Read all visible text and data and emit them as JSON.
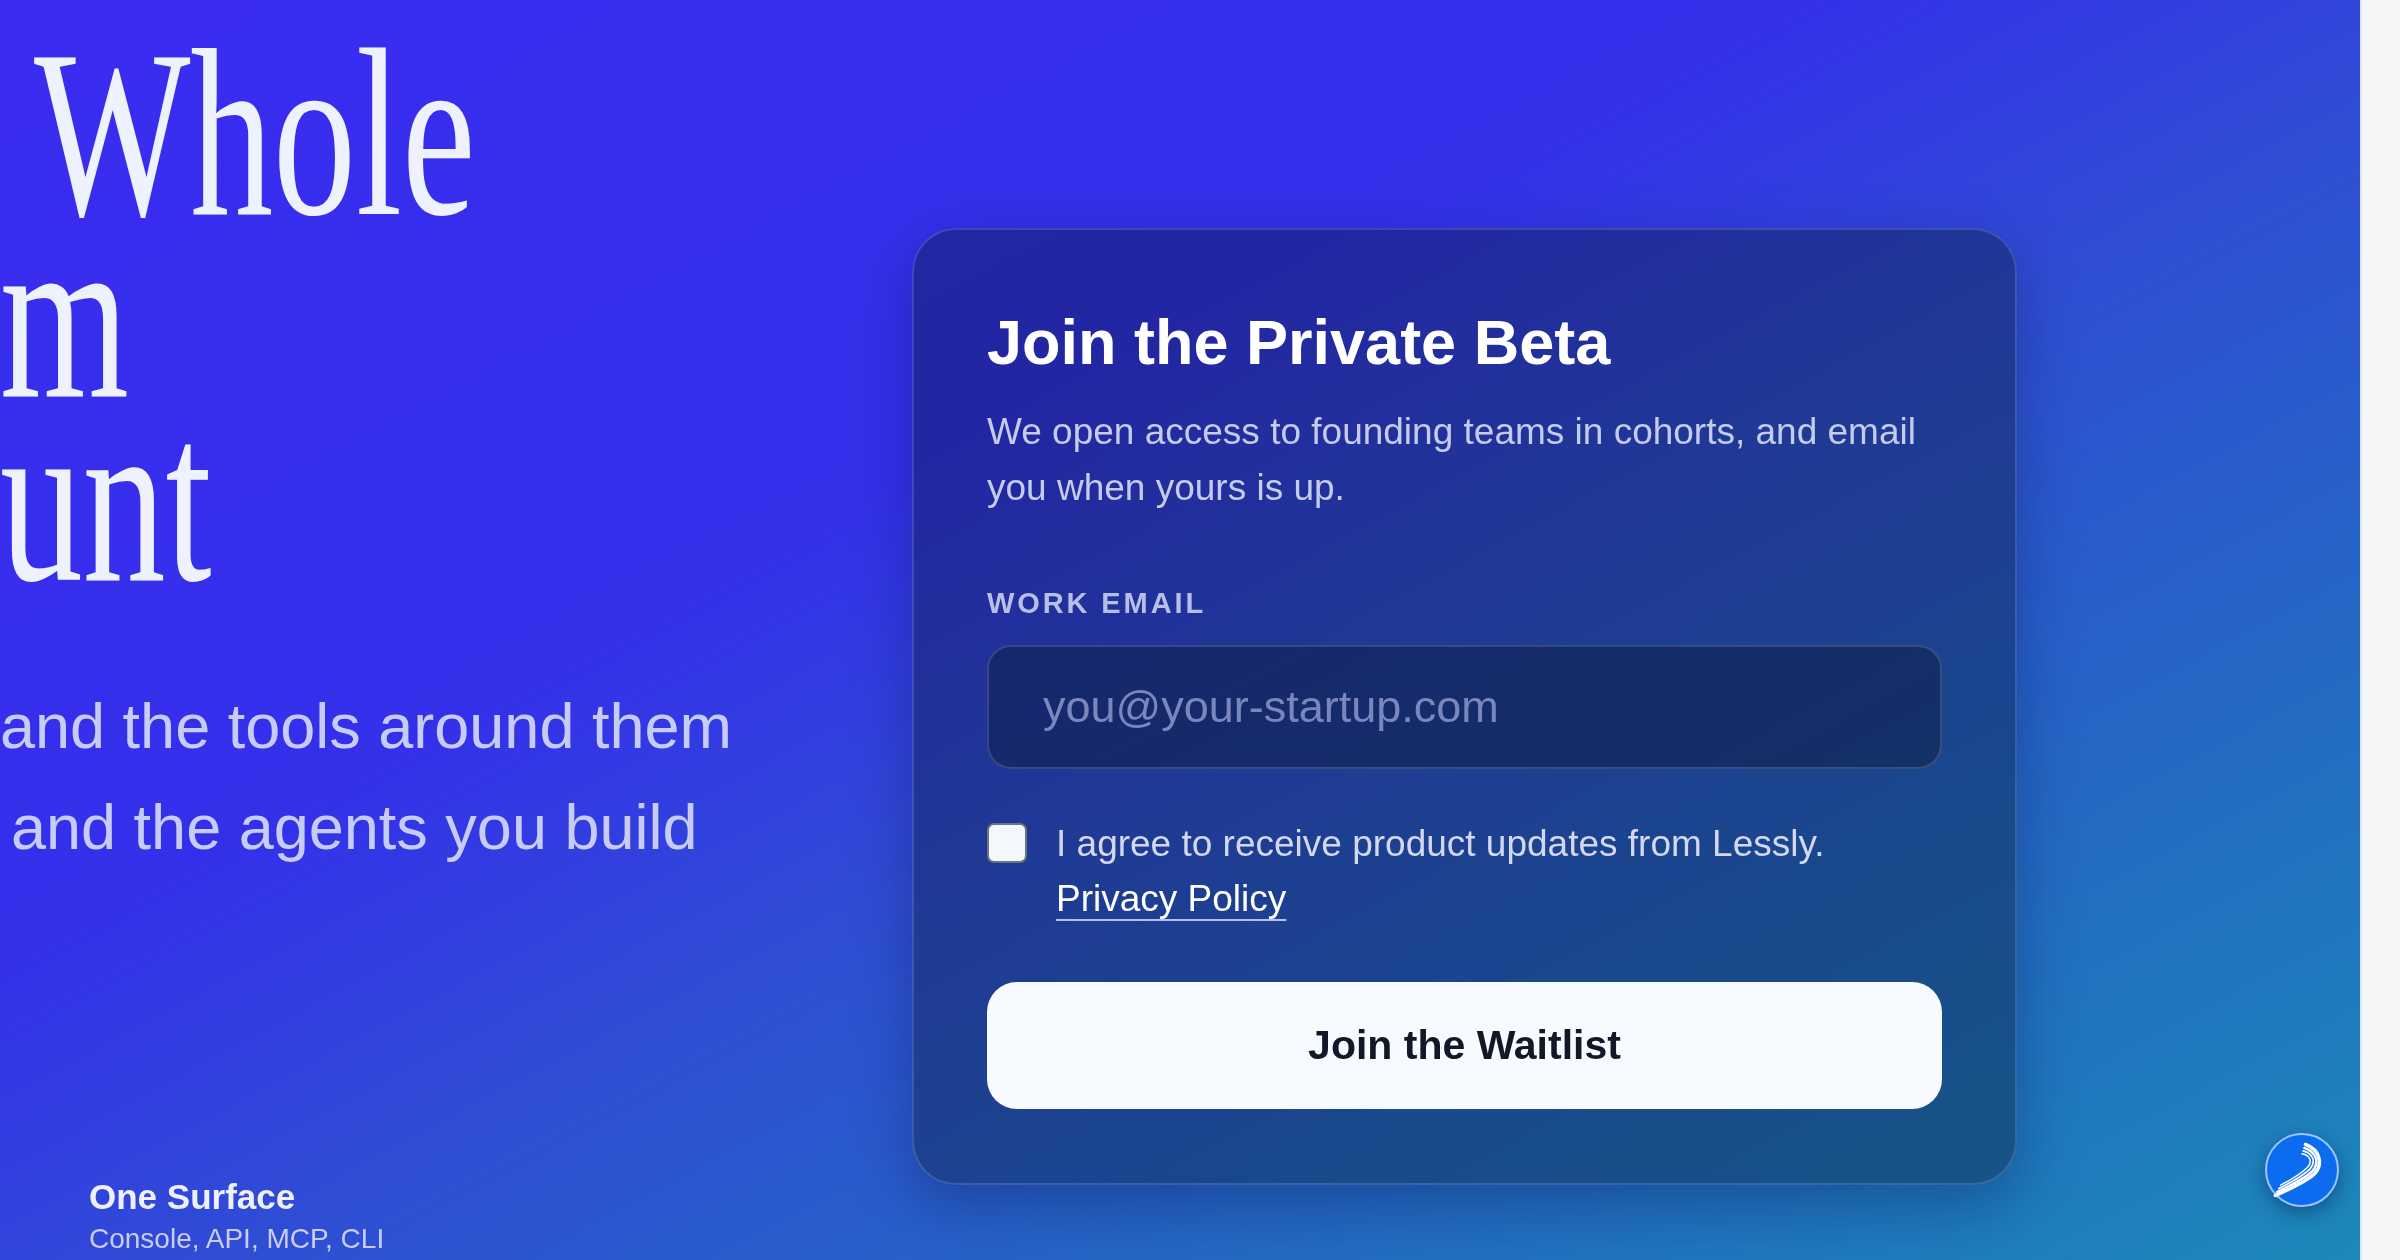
{
  "hero": {
    "headline_lines": [
      "Whole",
      "m",
      "unt"
    ],
    "subtitle_lines": [
      "and the tools around them",
      "and the agents you build"
    ],
    "feature": {
      "title": "One Surface",
      "description": "Console, API, MCP, CLI"
    }
  },
  "signup_card": {
    "title": "Join the Private Beta",
    "description": "We open access to founding teams in cohorts, and email you when yours is up.",
    "email_field": {
      "label": "WORK EMAIL",
      "placeholder": "you@your-startup.com"
    },
    "consent": {
      "checked": false,
      "text": "I agree to receive product updates from Lessly.",
      "link": "Privacy Policy"
    },
    "submit_button": "Join the Waitlist"
  }
}
